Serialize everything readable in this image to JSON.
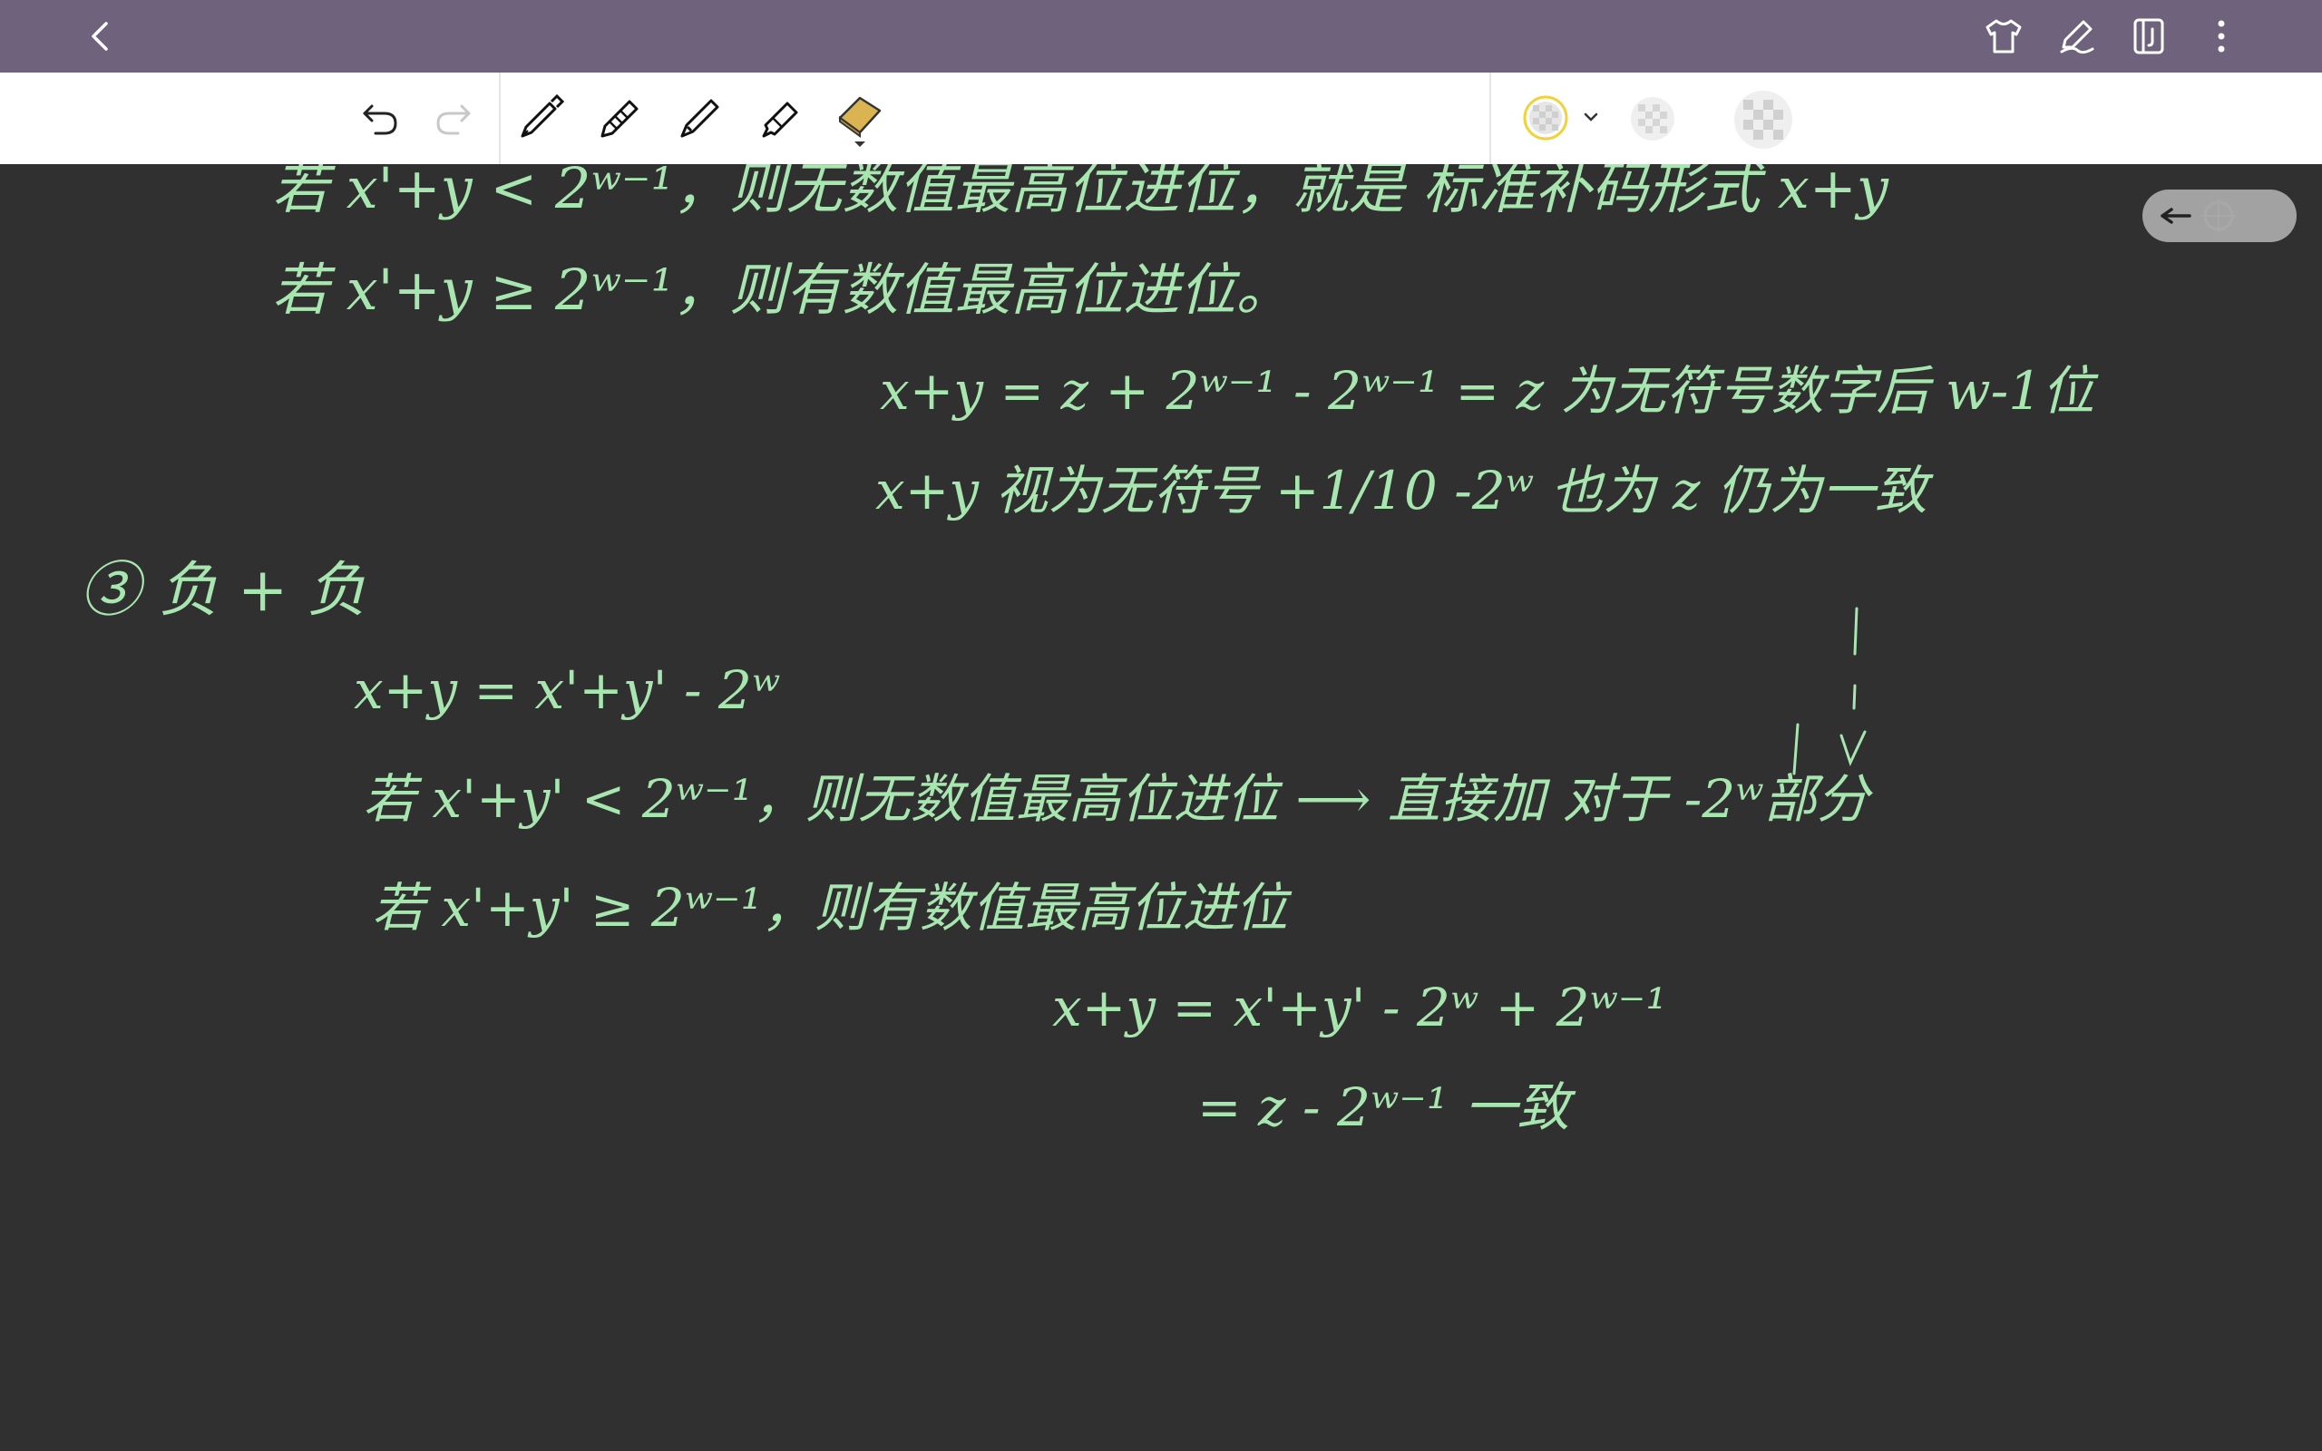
{
  "app": {
    "colors": {
      "topbar": "#6f627d",
      "ink": "#a8e6b0",
      "canvas": "#303030",
      "eraser": "#d9b450"
    }
  },
  "topbar": {
    "icons": [
      "back-chevron-icon",
      "shirt-icon",
      "pen-edit-icon",
      "book-icon",
      "more-vertical-icon"
    ]
  },
  "toolbar": {
    "tools": [
      "undo-icon",
      "redo-icon",
      "fountain-pen-icon",
      "pencil-icon",
      "ballpoint-pen-icon",
      "highlighter-icon",
      "eraser-icon"
    ],
    "color_selected": "#f2d23a"
  },
  "notes": {
    "line1": "若 x'+y < 2ʷ⁻¹，则无数值最高位进位，就是 标准补码形式 x+y",
    "line2": "若 x'+y ≥ 2ʷ⁻¹，则有数值最高位进位。",
    "line3": "x+y = z + 2ʷ⁻¹ - 2ʷ⁻¹ = z  为无符号数字后 w-1位",
    "line4": "x+y 视为无符号 +1/10  -2ʷ 也为 z  仍为一致",
    "line5": "③ 负 + 负",
    "line6": "x+y = x'+y' - 2ʷ",
    "line7": "若 x'+y' < 2ʷ⁻¹，则无数值最高位进位 ⟶ 直接加 对于 -2ʷ部分",
    "line8": "若 x'+y' ≥ 2ʷ⁻¹，则有数值最高位进位",
    "line9": "x+y = x'+y' - 2ʷ + 2ʷ⁻¹",
    "line10": "= z - 2ʷ⁻¹  一致"
  }
}
